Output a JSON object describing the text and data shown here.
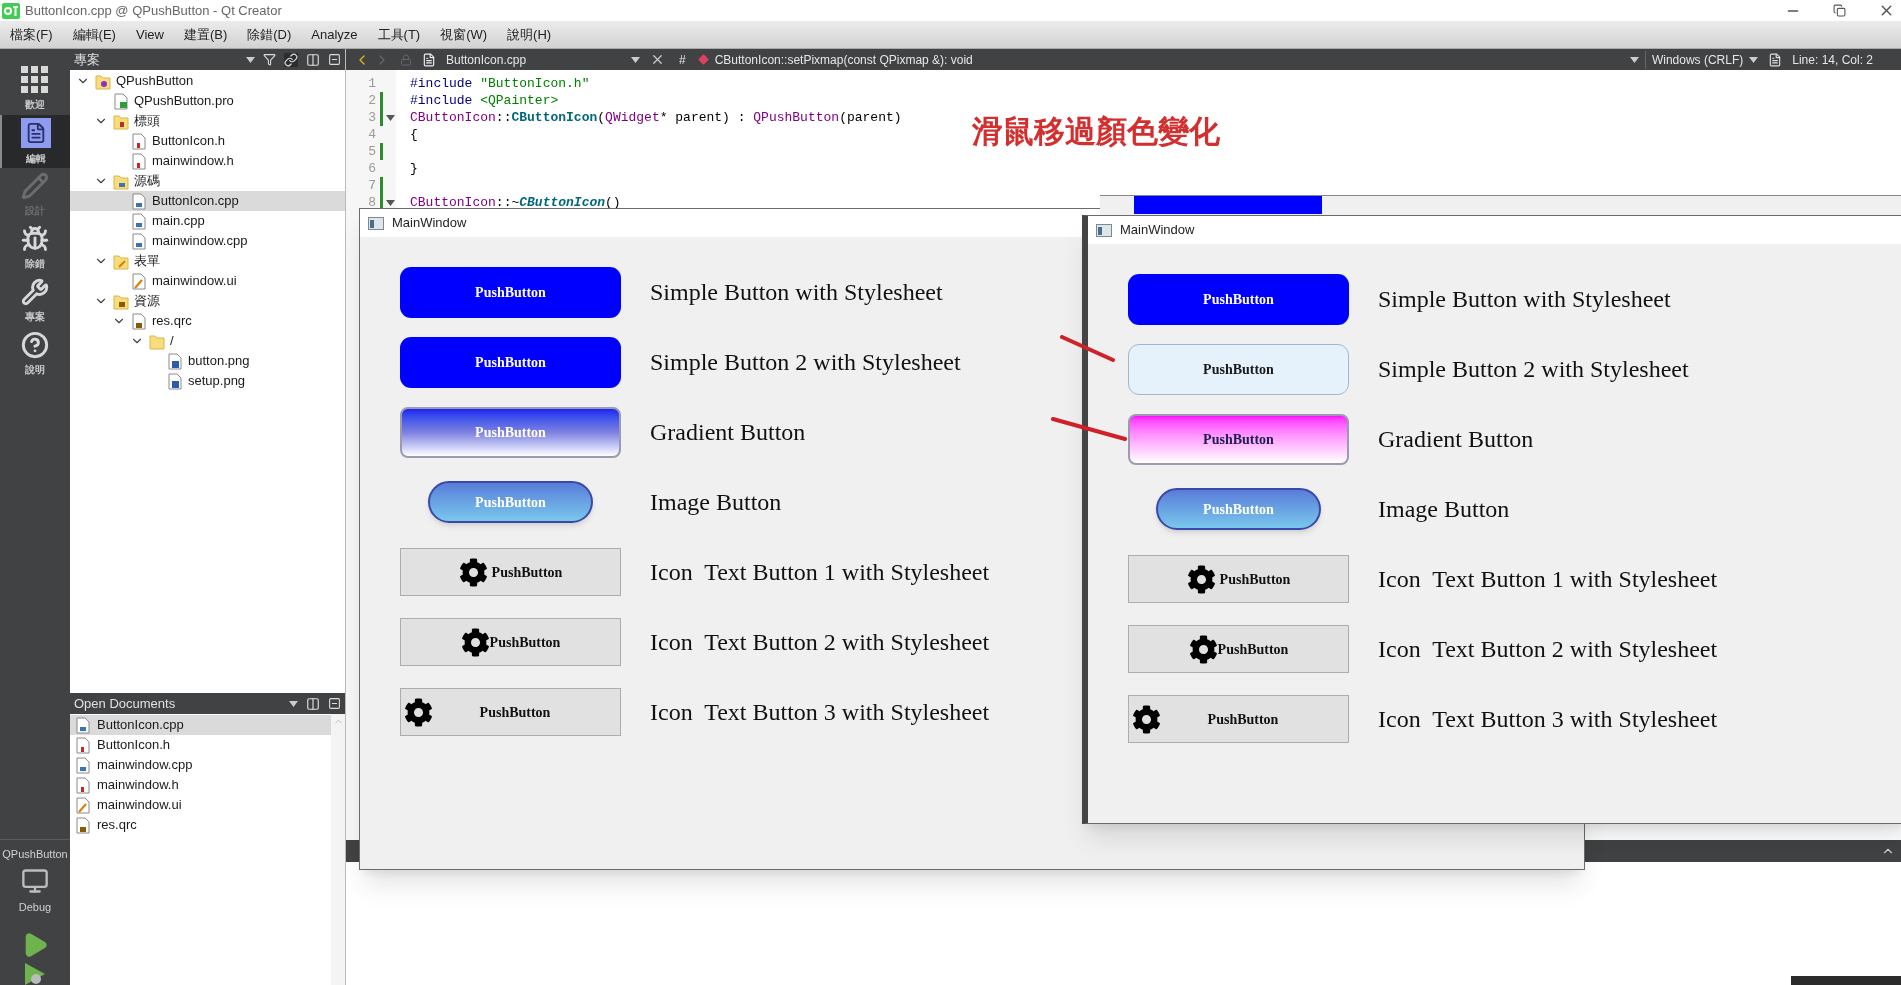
{
  "title_bar": {
    "title": "ButtonIcon.cpp @ QPushButton - Qt Creator"
  },
  "menu": [
    "檔案(F)",
    "編輯(E)",
    "View",
    "建置(B)",
    "除錯(D)",
    "Analyze",
    "工具(T)",
    "視窗(W)",
    "說明(H)"
  ],
  "mode_bar": {
    "modes": [
      {
        "label": "歡迎",
        "kind": "welcome",
        "selected": false,
        "disabled": false
      },
      {
        "label": "編輯",
        "kind": "edit",
        "selected": true,
        "disabled": false
      },
      {
        "label": "設計",
        "kind": "design",
        "selected": false,
        "disabled": true
      },
      {
        "label": "除錯",
        "kind": "debug",
        "selected": false,
        "disabled": false
      },
      {
        "label": "專案",
        "kind": "projects",
        "selected": false,
        "disabled": false
      },
      {
        "label": "說明",
        "kind": "help",
        "selected": false,
        "disabled": false
      }
    ],
    "target": {
      "project": "QPushButton",
      "config": "Debug"
    }
  },
  "project_pane": {
    "title": "專案",
    "tree": [
      {
        "label": "QPushButton",
        "kind": "project",
        "expanded": true,
        "selected": false,
        "children": [
          {
            "label": "QPushButton.pro",
            "kind": "pro",
            "selected": false
          },
          {
            "label": "標頭",
            "kind": "header-folder",
            "expanded": true,
            "selected": false,
            "children": [
              {
                "label": "ButtonIcon.h",
                "kind": "header",
                "selected": false
              },
              {
                "label": "mainwindow.h",
                "kind": "header",
                "selected": false
              }
            ]
          },
          {
            "label": "源碼",
            "kind": "source-folder",
            "expanded": true,
            "selected": false,
            "children": [
              {
                "label": "ButtonIcon.cpp",
                "kind": "source",
                "selected": true
              },
              {
                "label": "main.cpp",
                "kind": "source",
                "selected": false
              },
              {
                "label": "mainwindow.cpp",
                "kind": "source",
                "selected": false
              }
            ]
          },
          {
            "label": "表單",
            "kind": "form-folder",
            "expanded": true,
            "selected": false,
            "children": [
              {
                "label": "mainwindow.ui",
                "kind": "form",
                "selected": false
              }
            ]
          },
          {
            "label": "資源",
            "kind": "resource-folder",
            "expanded": true,
            "selected": false,
            "children": [
              {
                "label": "res.qrc",
                "kind": "resource",
                "expanded": true,
                "selected": false,
                "children": [
                  {
                    "label": "/",
                    "kind": "folder",
                    "expanded": true,
                    "selected": false,
                    "children": [
                      {
                        "label": "button.png",
                        "kind": "image",
                        "selected": false
                      },
                      {
                        "label": "setup.png",
                        "kind": "image",
                        "selected": false
                      }
                    ]
                  }
                ]
              }
            ]
          }
        ]
      }
    ]
  },
  "open_documents": {
    "title": "Open Documents",
    "files": [
      {
        "label": "ButtonIcon.cpp",
        "kind": "source",
        "selected": true
      },
      {
        "label": "ButtonIcon.h",
        "kind": "header",
        "selected": false
      },
      {
        "label": "mainwindow.cpp",
        "kind": "source",
        "selected": false
      },
      {
        "label": "mainwindow.h",
        "kind": "header",
        "selected": false
      },
      {
        "label": "mainwindow.ui",
        "kind": "form",
        "selected": false
      },
      {
        "label": "res.qrc",
        "kind": "resource",
        "selected": false
      }
    ]
  },
  "editor": {
    "file": "ButtonIcon.cpp",
    "hash": "#",
    "symbol": "CButtonIcon::setPixmap(const QPixmap &): void",
    "line_ending": "Windows (CRLF)",
    "position": "Line: 14, Col: 2",
    "lines": [
      {
        "number": "1",
        "modified": false,
        "foldable": false,
        "tokens": [
          {
            "kind": "preprocessor",
            "text": "#include "
          },
          {
            "kind": "string",
            "text": "\"ButtonIcon.h\""
          }
        ]
      },
      {
        "number": "2",
        "modified": true,
        "foldable": false,
        "tokens": [
          {
            "kind": "preprocessor",
            "text": "#include "
          },
          {
            "kind": "string",
            "text": "<QPainter>"
          }
        ]
      },
      {
        "number": "3",
        "modified": true,
        "foldable": true,
        "tokens": [
          {
            "kind": "type",
            "text": "CButtonIcon"
          },
          {
            "kind": "plain",
            "text": "::"
          },
          {
            "kind": "function",
            "text": "CButtonIcon"
          },
          {
            "kind": "plain",
            "text": "("
          },
          {
            "kind": "type",
            "text": "QWidget"
          },
          {
            "kind": "plain",
            "text": "* parent) : "
          },
          {
            "kind": "type",
            "text": "QPushButton"
          },
          {
            "kind": "plain",
            "text": "(parent)"
          }
        ]
      },
      {
        "number": "4",
        "modified": false,
        "foldable": false,
        "tokens": [
          {
            "kind": "plain",
            "text": "{"
          }
        ]
      },
      {
        "number": "5",
        "modified": true,
        "foldable": false
      },
      {
        "number": "6",
        "modified": false,
        "foldable": false,
        "tokens": [
          {
            "kind": "plain",
            "text": "}"
          }
        ]
      },
      {
        "number": "7",
        "modified": true,
        "foldable": false
      },
      {
        "number": "8",
        "modified": true,
        "foldable": true,
        "tokens": [
          {
            "kind": "type",
            "text": "CButtonIcon"
          },
          {
            "kind": "plain",
            "text": "::~"
          },
          {
            "kind": "virtual",
            "text": "CButtonIcon"
          },
          {
            "kind": "plain",
            "text": "()"
          }
        ]
      }
    ]
  },
  "annotation": {
    "text": "滑鼠移過顏色變化"
  },
  "windows": [
    {
      "title": "MainWindow",
      "rows": [
        {
          "kind": "simple",
          "button": "PushButton",
          "hovered": false,
          "label": "Simple Button with Stylesheet"
        },
        {
          "kind": "simple",
          "button": "PushButton",
          "hovered": false,
          "label": "Simple Button 2 with Stylesheet"
        },
        {
          "kind": "gradient",
          "button": "PushButton",
          "hovered": false,
          "label": "Gradient Button"
        },
        {
          "kind": "image",
          "button": "PushButton",
          "hovered": false,
          "label": "Image Button"
        },
        {
          "kind": "icon",
          "button": "PushButton",
          "hovered": false,
          "label": "Icon  Text Button 1 with Stylesheet"
        },
        {
          "kind": "icon-tight",
          "button": "PushButton",
          "hovered": false,
          "label": "Icon  Text Button 2 with Stylesheet"
        },
        {
          "kind": "icon-left",
          "button": "PushButton",
          "hovered": false,
          "label": "Icon  Text Button 3 with Stylesheet"
        }
      ]
    },
    {
      "title": "MainWindow",
      "rows": [
        {
          "kind": "simple",
          "button": "PushButton",
          "hovered": false,
          "label": "Simple Button with Stylesheet"
        },
        {
          "kind": "simple",
          "button": "PushButton",
          "hovered": true,
          "label": "Simple Button 2 with Stylesheet"
        },
        {
          "kind": "gradient",
          "button": "PushButton",
          "hovered": true,
          "label": "Gradient Button"
        },
        {
          "kind": "image",
          "button": "PushButton",
          "hovered": false,
          "label": "Image Button"
        },
        {
          "kind": "icon",
          "button": "PushButton",
          "hovered": false,
          "label": "Icon  Text Button 1 with Stylesheet"
        },
        {
          "kind": "icon-tight",
          "button": "PushButton",
          "hovered": false,
          "label": "Icon  Text Button 2 with Stylesheet"
        },
        {
          "kind": "icon-left",
          "button": "PushButton",
          "hovered": false,
          "label": "Icon  Text Button 3 with Stylesheet"
        }
      ]
    }
  ]
}
